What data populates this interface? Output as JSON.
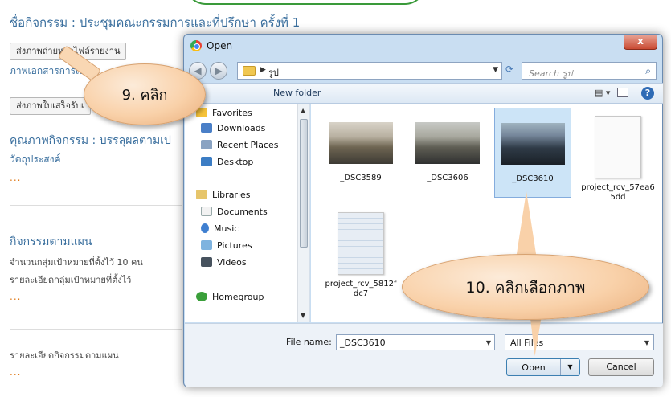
{
  "page": {
    "activity_title": "ชื่อกิจกรรม : ประชุมคณะกรรมการและที่ปรึกษา ครั้งที่ 1",
    "upload_photo_button": "ส่งภาพถ่ายหรือไฟล์รายงาน",
    "finance_docs_label": "ภาพเอกสารการเงิน",
    "upload_receipt_button": "ส่งภาพใบเสร็จรับเ",
    "quality_heading": "คุณภาพกิจกรรม : บรรลุผลตามเป",
    "objectives_label": "วัตถุประสงค์",
    "dots1": "...",
    "planned_heading": "กิจกรรมตามแผน",
    "target_count": "จำนวนกลุ่มเป้าหมายที่ตั้งไว้ 10 คน",
    "target_detail": "รายละเอียดกลุ่มเป้าหมายที่ตั้งไว้",
    "dots2": "...",
    "plan_detail": "รายละเอียดกิจกรรมตามแผน",
    "dots3": "..."
  },
  "dialog": {
    "title": "Open",
    "close_label": "x",
    "address_path": "รูป",
    "search_placeholder": "Search รูป",
    "toolbar_new_folder": "New folder",
    "nav": [
      {
        "label": "Favorites",
        "icon": "star-icon"
      },
      {
        "label": "Downloads",
        "icon": "downloads-icon"
      },
      {
        "label": "Recent Places",
        "icon": "recent-places-icon"
      },
      {
        "label": "Desktop",
        "icon": "desktop-icon"
      },
      {
        "label": "Libraries",
        "icon": "libraries-icon"
      },
      {
        "label": "Documents",
        "icon": "documents-icon"
      },
      {
        "label": "Music",
        "icon": "music-icon"
      },
      {
        "label": "Pictures",
        "icon": "pictures-icon"
      },
      {
        "label": "Videos",
        "icon": "videos-icon"
      },
      {
        "label": "Homegroup",
        "icon": "homegroup-icon"
      }
    ],
    "files": [
      {
        "name": "_DSC3589",
        "kind": "photo"
      },
      {
        "name": "_DSC3606",
        "kind": "photo"
      },
      {
        "name": "_DSC3610",
        "kind": "photo",
        "selected": true
      },
      {
        "name": "project_rcv_57ea65dd",
        "kind": "document"
      },
      {
        "name": "project_rcv_5812fdc7",
        "kind": "document"
      }
    ],
    "file_name_label": "File name:",
    "file_name_value": "_DSC3610",
    "file_type_value": "All Files",
    "open_button": "Open",
    "cancel_button": "Cancel"
  },
  "callouts": {
    "step9": "9. คลิก",
    "step10": "10. คลิกเลือกภาพ"
  }
}
